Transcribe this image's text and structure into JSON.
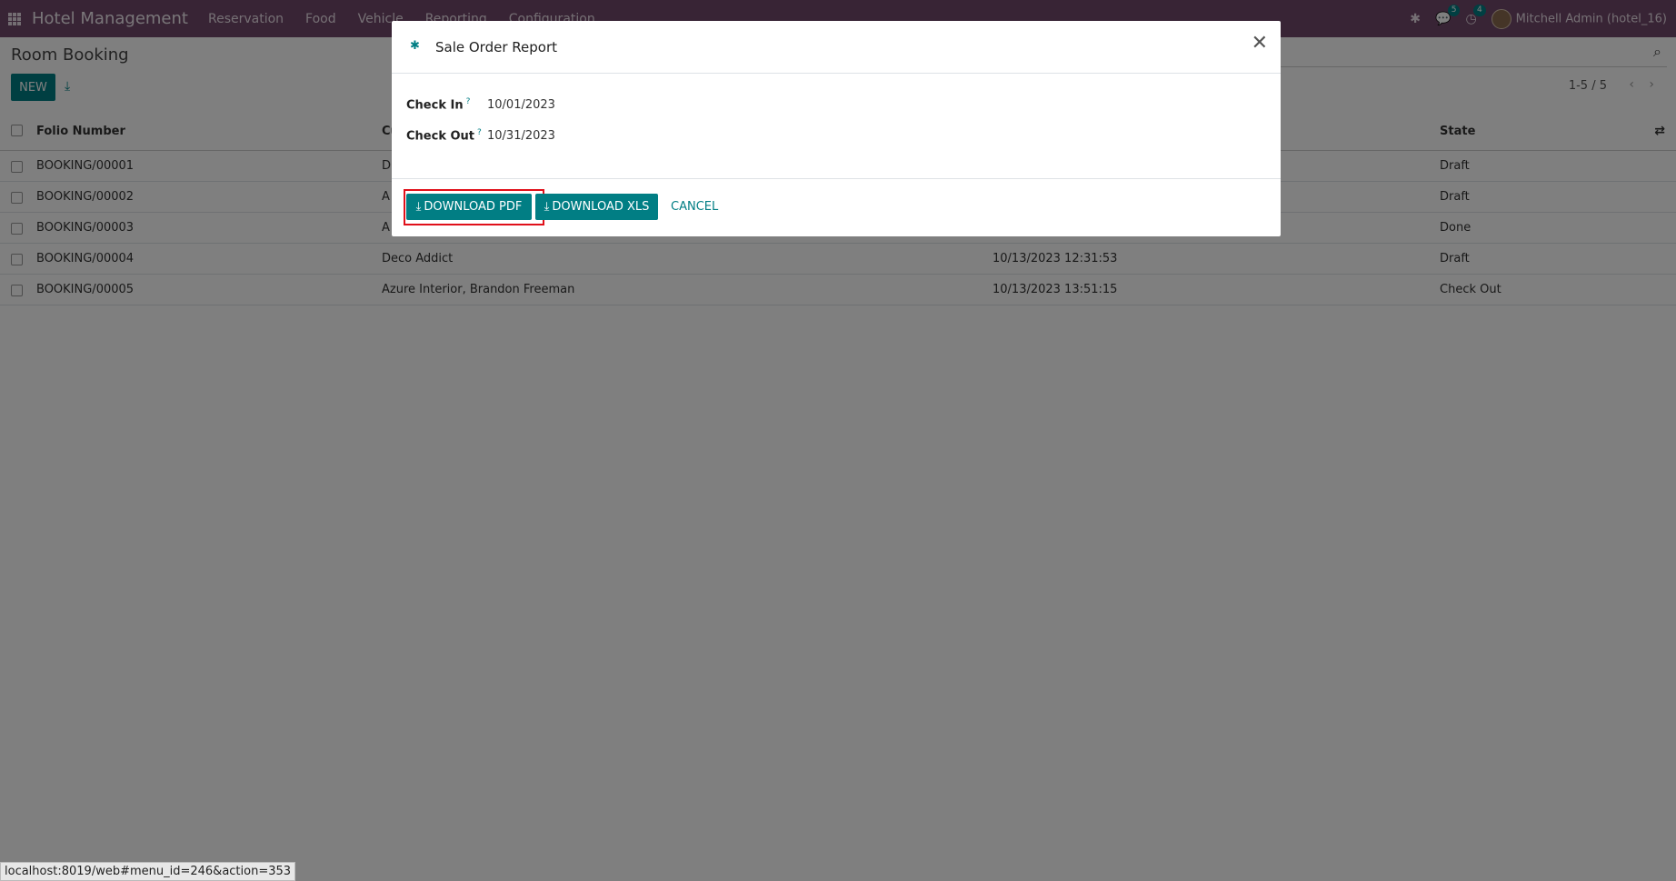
{
  "navbar": {
    "app_title": "Hotel Management",
    "menu": [
      "Reservation",
      "Food",
      "Vehicle",
      "Reporting",
      "Configuration"
    ],
    "messages_count": "5",
    "activities_count": "4",
    "user": "Mitchell Admin (hotel_16)"
  },
  "control_panel": {
    "title": "Room Booking",
    "new_label": "NEW",
    "pager": "1-5 / 5"
  },
  "table": {
    "headers": {
      "folio": "Folio Number",
      "customer": "Cu",
      "state": "State"
    },
    "rows": [
      {
        "folio": "BOOKING/00001",
        "customer": "D",
        "date": "",
        "state": "Draft"
      },
      {
        "folio": "BOOKING/00002",
        "customer": "A",
        "date": "",
        "state": "Draft"
      },
      {
        "folio": "BOOKING/00003",
        "customer": "A",
        "date": "",
        "state": "Done"
      },
      {
        "folio": "BOOKING/00004",
        "customer": "Deco Addict",
        "date": "10/13/2023 12:31:53",
        "state": "Draft"
      },
      {
        "folio": "BOOKING/00005",
        "customer": "Azure Interior, Brandon Freeman",
        "date": "10/13/2023 13:51:15",
        "state": "Check Out"
      }
    ]
  },
  "dialog": {
    "title": "Sale Order Report",
    "check_in_label": "Check In",
    "check_in_value": "10/01/2023",
    "check_out_label": "Check Out",
    "check_out_value": "10/31/2023",
    "help_mark": "?",
    "download_pdf": "DOWNLOAD PDF",
    "download_xls": "DOWNLOAD XLS",
    "cancel": "CANCEL"
  },
  "status_bar": {
    "url": "localhost:8019/web#menu_id=246&action=353"
  },
  "colors": {
    "navbar": "#71486a",
    "primary": "#017e84",
    "highlight": "#e0101a"
  }
}
